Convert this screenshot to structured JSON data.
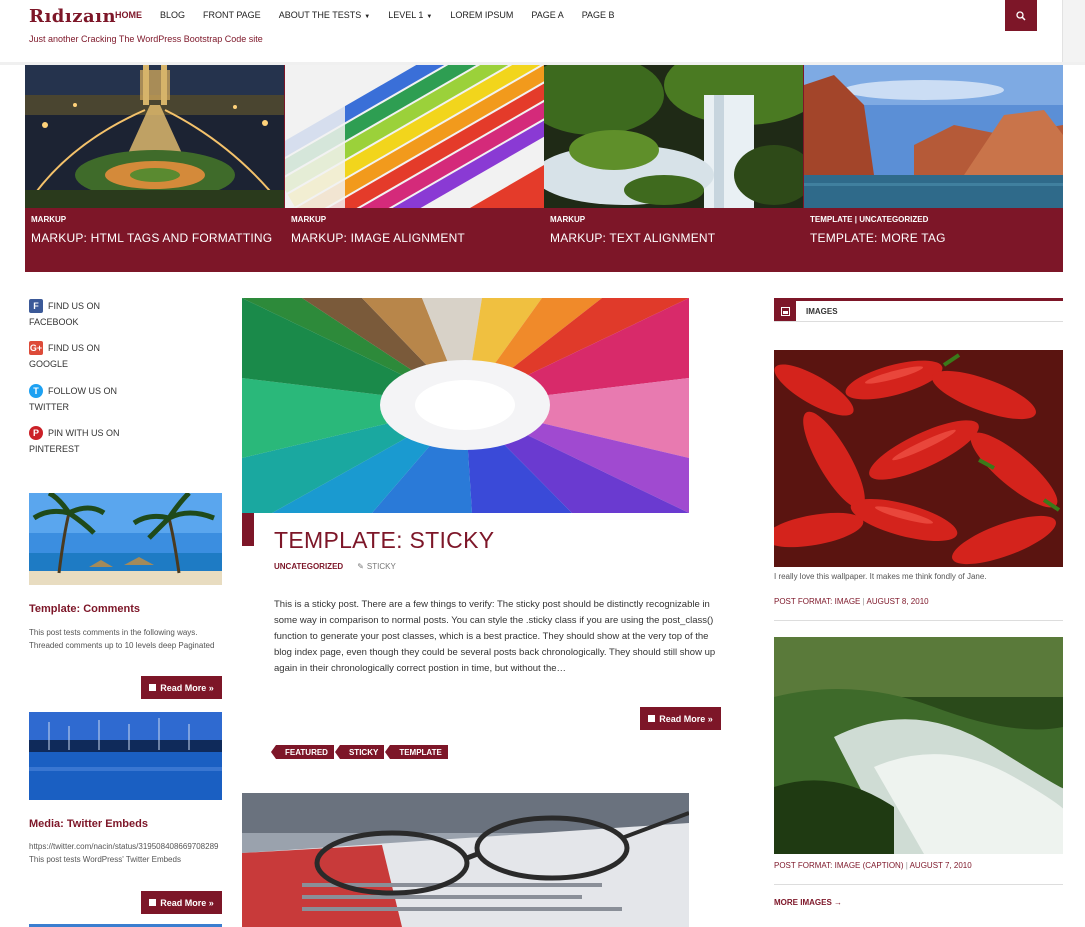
{
  "site": {
    "logo": "Rıdızaın",
    "tagline": "Just another Cracking The WordPress Bootstrap Code site"
  },
  "nav": {
    "items": [
      {
        "label": "Home",
        "active": true,
        "dropdown": false
      },
      {
        "label": "Blog",
        "active": false,
        "dropdown": false
      },
      {
        "label": "Front Page",
        "active": false,
        "dropdown": false
      },
      {
        "label": "About The Tests",
        "active": false,
        "dropdown": true
      },
      {
        "label": "Level 1",
        "active": false,
        "dropdown": true
      },
      {
        "label": "Lorem Ipsum",
        "active": false,
        "dropdown": false
      },
      {
        "label": "Page A",
        "active": false,
        "dropdown": false
      },
      {
        "label": "Page B",
        "active": false,
        "dropdown": false
      }
    ],
    "search_icon": "search-icon"
  },
  "featured": [
    {
      "category": "Markup",
      "title": "Markup: HTML Tags and Formatting",
      "image": "night-bridge-city"
    },
    {
      "category": "Markup",
      "title": "Markup: Image Alignment",
      "image": "color-crayons"
    },
    {
      "category": "Markup",
      "title": "Markup: Text Alignment",
      "image": "waterfall"
    },
    {
      "category": "Template | Uncategorized",
      "title": "Template: More Tag",
      "image": "canyon-lake"
    }
  ],
  "social": [
    {
      "line1": "Find us on",
      "line2": "Facebook",
      "icon": "facebook-icon",
      "color": "#3b5998",
      "glyph": "f"
    },
    {
      "line1": "Find us on",
      "line2": "Google",
      "icon": "google-plus-icon",
      "color": "#dd4b39",
      "glyph": "g+"
    },
    {
      "line1": "Follow us on",
      "line2": "Twitter",
      "icon": "twitter-icon",
      "color": "#1da1f2",
      "glyph": "t"
    },
    {
      "line1": "Pin with us on",
      "line2": "Pinterest",
      "icon": "pinterest-icon",
      "color": "#cb2027",
      "glyph": "p"
    }
  ],
  "left_posts": [
    {
      "title": "Template: Comments",
      "excerpt": "This post tests comments in the following ways. Threaded comments up to 10 levels deep Paginated",
      "read_more": "Read More »",
      "image": "palm-beach"
    },
    {
      "title": "Media: Twitter Embeds",
      "excerpt": "https://twitter.com/nacin/status/319508408669708289 This post tests WordPress' Twitter Embeds",
      "read_more": "Read More »",
      "image": "harbor-night"
    }
  ],
  "main_post": {
    "title": "Template: Sticky",
    "category": "Uncategorized",
    "sticky_label": "Sticky",
    "body": "This is a sticky post. There are a few things to verify: The sticky post should be distinctly recognizable in some way in comparison to normal posts. You can style the .sticky class if you are using the post_class() function to generate your post classes, which is a best practice. They should show at the very top of the blog index page, even though they could be several posts back chronologically. They should still show up again in their chronologically correct postion in time, but without the…",
    "read_more": "Read More »",
    "tags": [
      "Featured",
      "Sticky",
      "Template"
    ],
    "image": "colored-pencils-circle"
  },
  "second_post": {
    "image": "glasses-newspaper"
  },
  "images_widget": {
    "title": "Images",
    "items": [
      {
        "image": "red-chili-peppers",
        "caption": "I really love this wallpaper. It makes me think fondly of Jane.",
        "format": "Post Format: Image",
        "date": "August 8, 2010"
      },
      {
        "image": "river-rapids",
        "caption": "",
        "format": "Post Format: Image (Caption)",
        "date": "August 7, 2010"
      }
    ],
    "more_link": "More Images →"
  },
  "colors": {
    "accent": "#7d1628"
  }
}
